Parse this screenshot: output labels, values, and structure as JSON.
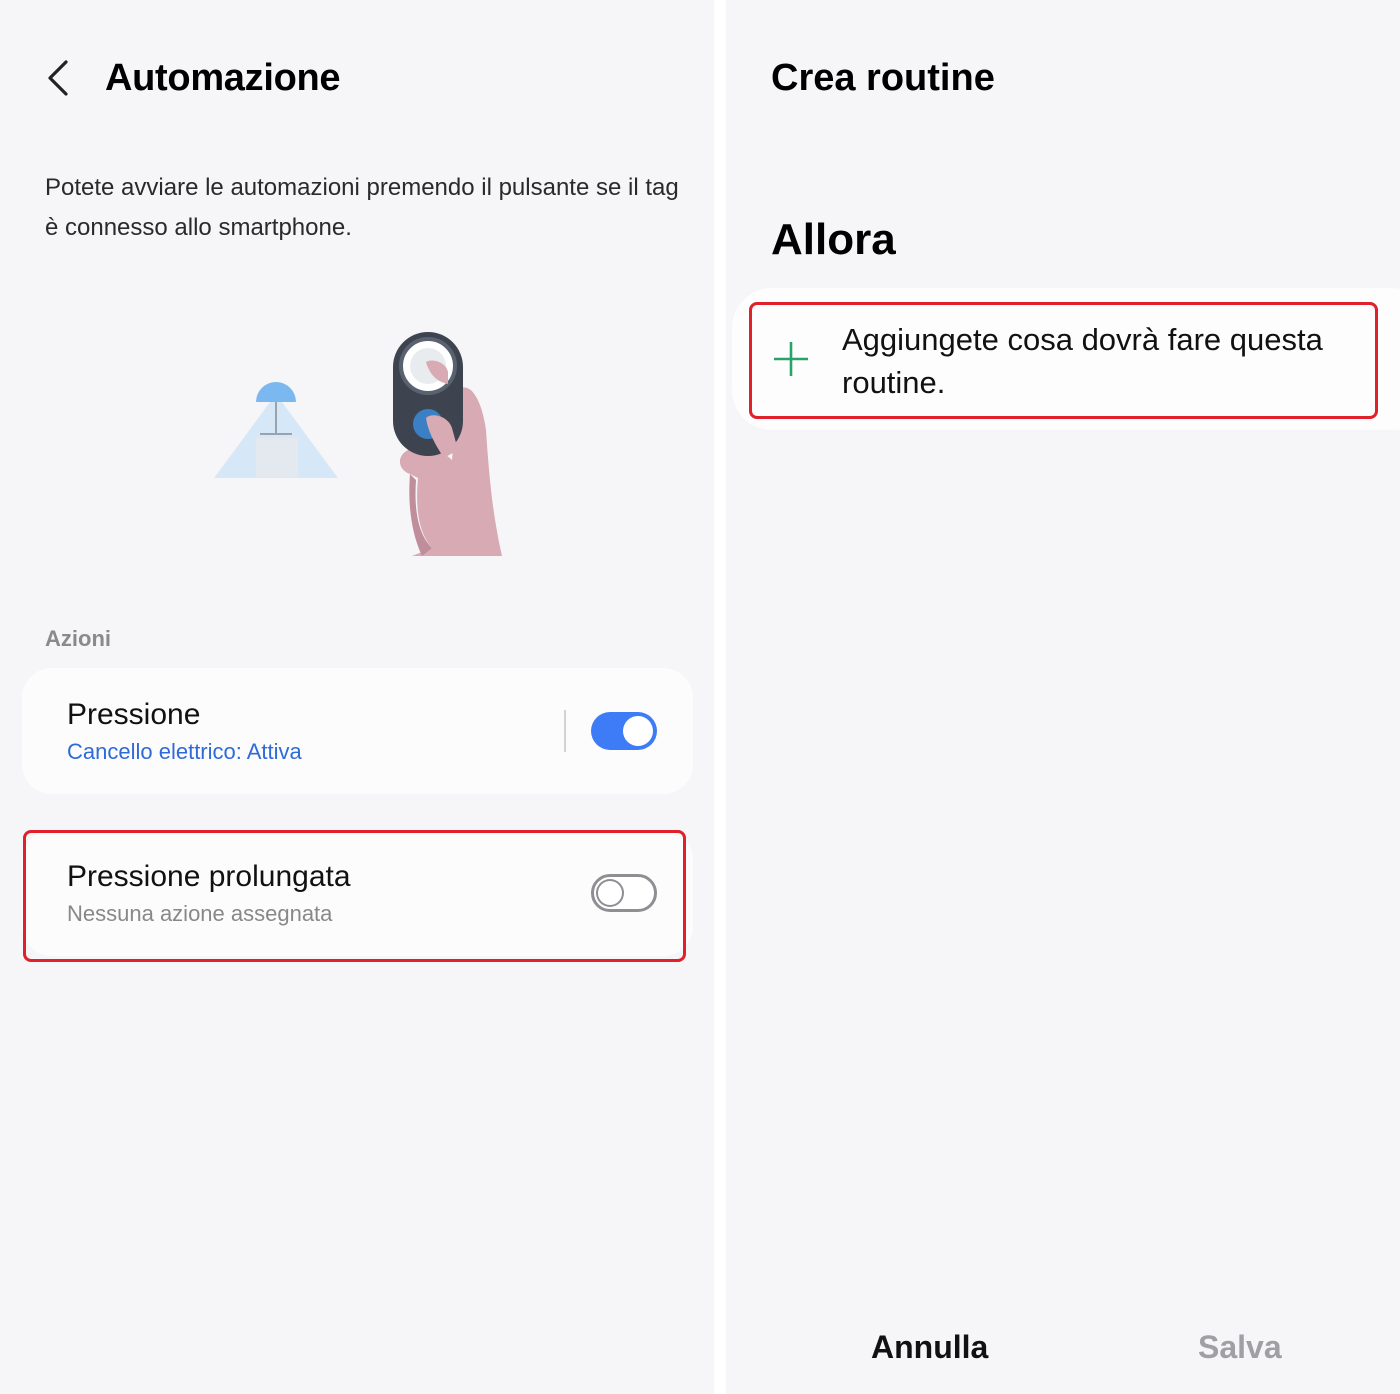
{
  "left": {
    "title": "Automazione",
    "description": "Potete avviare le automazioni premendo il pulsante se il tag è connesso allo smartphone.",
    "section_label": "Azioni",
    "items": [
      {
        "title": "Pressione",
        "subtitle": "Cancello elettrico: Attiva",
        "enabled": true
      },
      {
        "title": "Pressione prolungata",
        "subtitle": "Nessuna azione assegnata",
        "enabled": false
      }
    ]
  },
  "right": {
    "title": "Crea routine",
    "then_heading": "Allora",
    "add_action_label": "Aggiungete cosa dovrà fare questa routine.",
    "cancel_label": "Annulla",
    "save_label": "Salva"
  },
  "colors": {
    "background": "#f6f6f8",
    "card": "#fcfcfd",
    "accent_blue": "#3e7bf6",
    "subtitle_blue": "#2f6bd8",
    "highlight_red": "#e0202a",
    "plus_green": "#2aa36b"
  },
  "icons": {
    "back": "chevron-left-icon",
    "add": "plus-icon"
  }
}
